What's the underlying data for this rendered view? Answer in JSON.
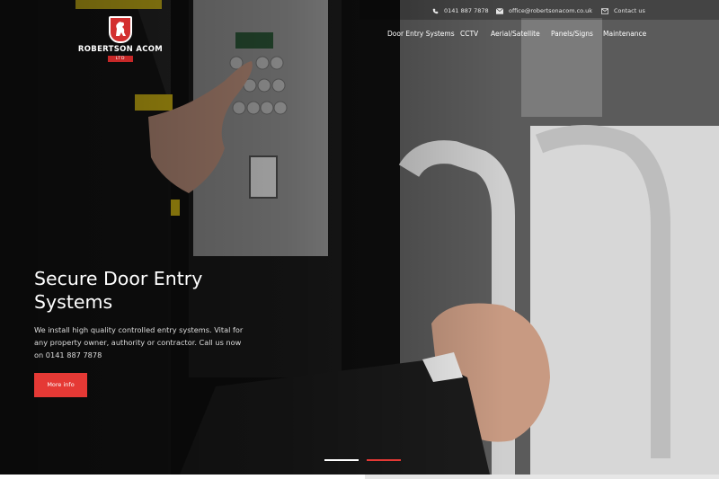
{
  "brand": {
    "name": "ROBERTSON ACOM",
    "ltd": "LTD",
    "logo_icon": "lion-shield-icon",
    "logo_color": "#d32f2f"
  },
  "contact": {
    "phone": "0141 887 7878",
    "email": "office@robertsonacom.co.uk",
    "contact_label": "Contact us",
    "phone_icon": "phone-icon",
    "email_icon": "envelope-icon",
    "contact_icon": "envelope-outline-icon"
  },
  "nav": {
    "items": [
      {
        "label": "Door Entry Systems"
      },
      {
        "label": "CCTV"
      },
      {
        "label": "Aerial/Satellite"
      },
      {
        "label": "Panels/Signs"
      },
      {
        "label": "Maintenance"
      }
    ]
  },
  "hero": {
    "title_line1": "Secure Door Entry",
    "title_line2": "Systems",
    "description": "We install high quality controlled entry systems. Vital for any property owner, authority or contractor. Call us now on 0141 887 7878",
    "cta_label": "More info",
    "cta_color": "#e53935"
  },
  "slider": {
    "count": 2,
    "active_index": 1,
    "inactive_color": "#ffffff",
    "active_color": "#e53935"
  }
}
